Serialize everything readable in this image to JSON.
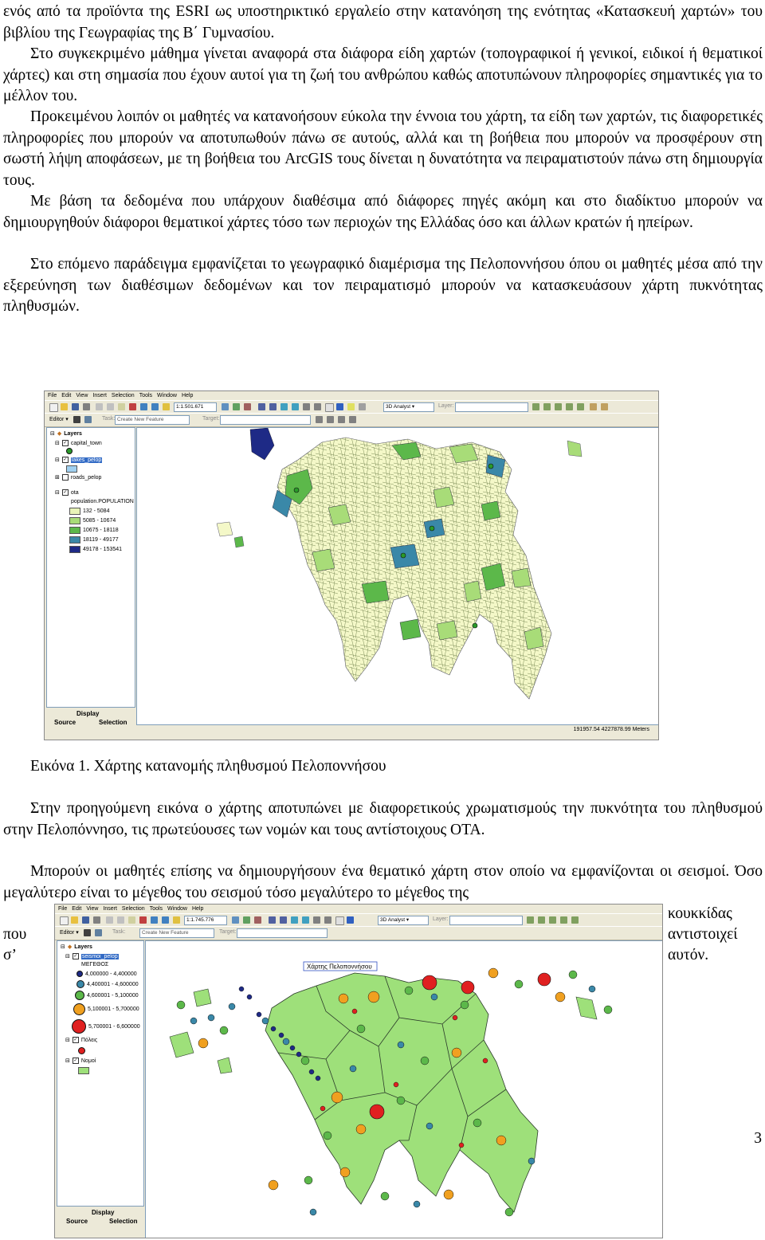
{
  "paragraphs": {
    "p0": "ενός από τα προϊόντα της ESRI ως υποστηρικτικό εργαλείο στην κατανόηση της ενότητας «Κατασκευή χαρτών» του βιβλίου της Γεωγραφίας της Β΄ Γυμνασίου.",
    "p1": "Στο συγκεκριμένο μάθημα γίνεται αναφορά στα διάφορα είδη χαρτών (τοπογραφικοί ή γενικοί, ειδικοί ή θεματικοί χάρτες) και στη σημασία που έχουν αυτοί για τη ζωή του ανθρώπου καθώς αποτυπώνουν πληροφορίες σημαντικές για το μέλλον του.",
    "p2": "Προκειμένου λοιπόν οι μαθητές να κατανοήσουν εύκολα την έννοια του χάρτη, τα είδη των χαρτών, τις διαφορετικές πληροφορίες που μπορούν να αποτυπωθούν πάνω σε αυτούς, αλλά και τη βοήθεια που μπορούν να προσφέρουν στη σωστή λήψη αποφάσεων, με τη βοήθεια του ArcGIS τους δίνεται η δυνατότητα να πειραματιστούν πάνω στη δημιουργία τους.",
    "p3": "Με βάση τα δεδομένα που υπάρχουν διαθέσιμα από διάφορες πηγές ακόμη και στο διαδίκτυο μπορούν να δημιουργηθούν διάφοροι θεματικοί χάρτες τόσο των περιοχών της Ελλάδας όσο και άλλων κρατών ή ηπείρων.",
    "p4": "Στο επόμενο παράδειγμα εμφανίζεται το γεωγραφικό διαμέρισμα της Πελοποννήσου όπου οι μαθητές μέσα από την εξερεύνηση των διαθέσιμων δεδομένων και τον πειραματισμό μπορούν να κατασκευάσουν χάρτη πυκνότητας πληθυσμών.",
    "caption": "Εικόνα 1. Χάρτης κατανομής πληθυσμού Πελοποννήσου",
    "p5": "Στην προηγούμενη εικόνα ο χάρτης αποτυπώνει με διαφορετικούς χρωματισμούς την πυκνότητα του πληθυσμού στην Πελοπόννησο, τις πρωτεύουσες των νομών και τους αντίστοιχους ΟΤΑ.",
    "p6": "Μπορούν οι μαθητές επίσης να δημιουργήσουν ένα θεματικό χάρτη στον οποίο να εμφανίζονται οι σεισμοί. Όσο μεγαλύτερο είναι το μέγεθος του σεισμού τόσο μεγαλύτερο το μέγεθος της",
    "p6_r1": "κουκκίδας",
    "p6_l2": "που",
    "p6_r2": "αντιστοιχεί",
    "p6_l3": "σ’",
    "p6_r3": "αυτόν.",
    "page_number": "3"
  },
  "arc_common": {
    "menu": [
      "File",
      "Edit",
      "View",
      "Insert",
      "Selection",
      "Tools",
      "Window",
      "Help"
    ],
    "analyst": "3D Analyst ▾",
    "layer_label": "Layer:",
    "editor": "Editor ▾",
    "task_label": "Task:",
    "task_value": "Create New Feature",
    "target_label": "Target:",
    "display_tab": "Display",
    "source_tab": "Source",
    "selection_tab": "Selection"
  },
  "arc1": {
    "scale": "1:1.501.671",
    "layers_title": "Layers",
    "layers": [
      {
        "name": "capital_town",
        "checked": true
      },
      {
        "name": "lakes_pelop",
        "checked": true,
        "selected": true
      },
      {
        "name": "roads_pelop",
        "checked": false
      },
      {
        "name": "ota",
        "checked": true
      }
    ],
    "field": "population.POPULATION",
    "legend": [
      {
        "label": "132 - 5084",
        "color": "#e8f4b8"
      },
      {
        "label": "5085 - 10674",
        "color": "#a8dc78"
      },
      {
        "label": "10675 - 18118",
        "color": "#5cb84a"
      },
      {
        "label": "18119 - 49177",
        "color": "#3a88a8"
      },
      {
        "label": "49178 - 153541",
        "color": "#1e2a86"
      }
    ],
    "status": "191957.54  4227878.99 Meters"
  },
  "arc2": {
    "scale": "1:1.745.776",
    "layers_title": "Layers",
    "layer_selected": "seismoi_pelop",
    "field": "ΜΕΓΕΘΟΣ",
    "legend": [
      {
        "label": "4,000000 - 4,400000",
        "color": "#1e2a86"
      },
      {
        "label": "4,400001 - 4,600000",
        "color": "#3a88a8"
      },
      {
        "label": "4,600001 - 5,100000",
        "color": "#5cb84a"
      },
      {
        "label": "5,100001 - 5,700000",
        "color": "#f0a020"
      },
      {
        "label": "5,700001 - 6,600000",
        "color": "#e02020"
      }
    ],
    "extra_layers": [
      "Πόλεις",
      "Νομοί"
    ],
    "map_title": "Χάρτης Πελοποννήσου"
  },
  "colors": {
    "bg": "#ece9d8",
    "accent": "#316ac5"
  }
}
